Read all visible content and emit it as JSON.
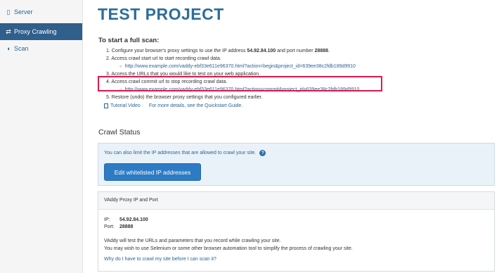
{
  "sidebar": {
    "items": [
      {
        "label": "Server",
        "icon": "server-icon",
        "glyph": "▯"
      },
      {
        "label": "Proxy Crawling",
        "icon": "arrows-icon",
        "glyph": "⇄"
      },
      {
        "label": "Scan",
        "icon": "shield-icon",
        "glyph": "◖"
      }
    ]
  },
  "page": {
    "title": "TEST PROJECT",
    "subtitle": "To start a full scan:"
  },
  "steps": {
    "s1_pre": "1. Configure your browser's proxy settings to use the IP address ",
    "s1_ip": "54.92.84.100",
    "s1_mid": " and port number ",
    "s1_port": "28888",
    "s1_post": ".",
    "s2": "2. Access crawl start url to start recording crawl data.",
    "s2_url": "http://www.example.com/vaddy-ebf33e611e96370.html?action=begin&project_id=639ee38c2fdb189d9910",
    "s3": "3. Access the URLs that you would like to test on your web application.",
    "s4": "4. Access crawl commit url to stop recording crawl data.",
    "s4_url": "http://www.example.com/vaddy-ebf33e611e96370.html?action=commit&project_id=639ee38c2fdb189d9910",
    "s5": "5. Restore (undo) the browser proxy settings that you configured earlier."
  },
  "links": {
    "tutorial": "Tutorial Video",
    "details": "For more details, see the Quickstart Guide."
  },
  "crawl_status": {
    "title": "Crawl Status",
    "info_text": "You can also limit the IP addresses that are allowed to crawl your site.",
    "help_glyph": "?",
    "edit_button": "Edit whitelisted IP addresses"
  },
  "proxy_panel": {
    "heading": "VAddy Proxy IP and Port",
    "ip_label": "IP:",
    "ip_value": "54.92.84.100",
    "port_label": "Port:",
    "port_value": "28888",
    "note1": "VAddy will test the URLs and parameters that you record while crawling your site.",
    "note2": "You may wish to use Selenium or some other browser automation tool to simplify the process of crawling your site.",
    "faq_link": "Why do I have to crawl my site before I can scan it?"
  },
  "colors": {
    "accent": "#2d6e98",
    "sidebar_active": "#2f5f8a",
    "highlight_border": "#e0184d",
    "button": "#2d7bc4"
  }
}
